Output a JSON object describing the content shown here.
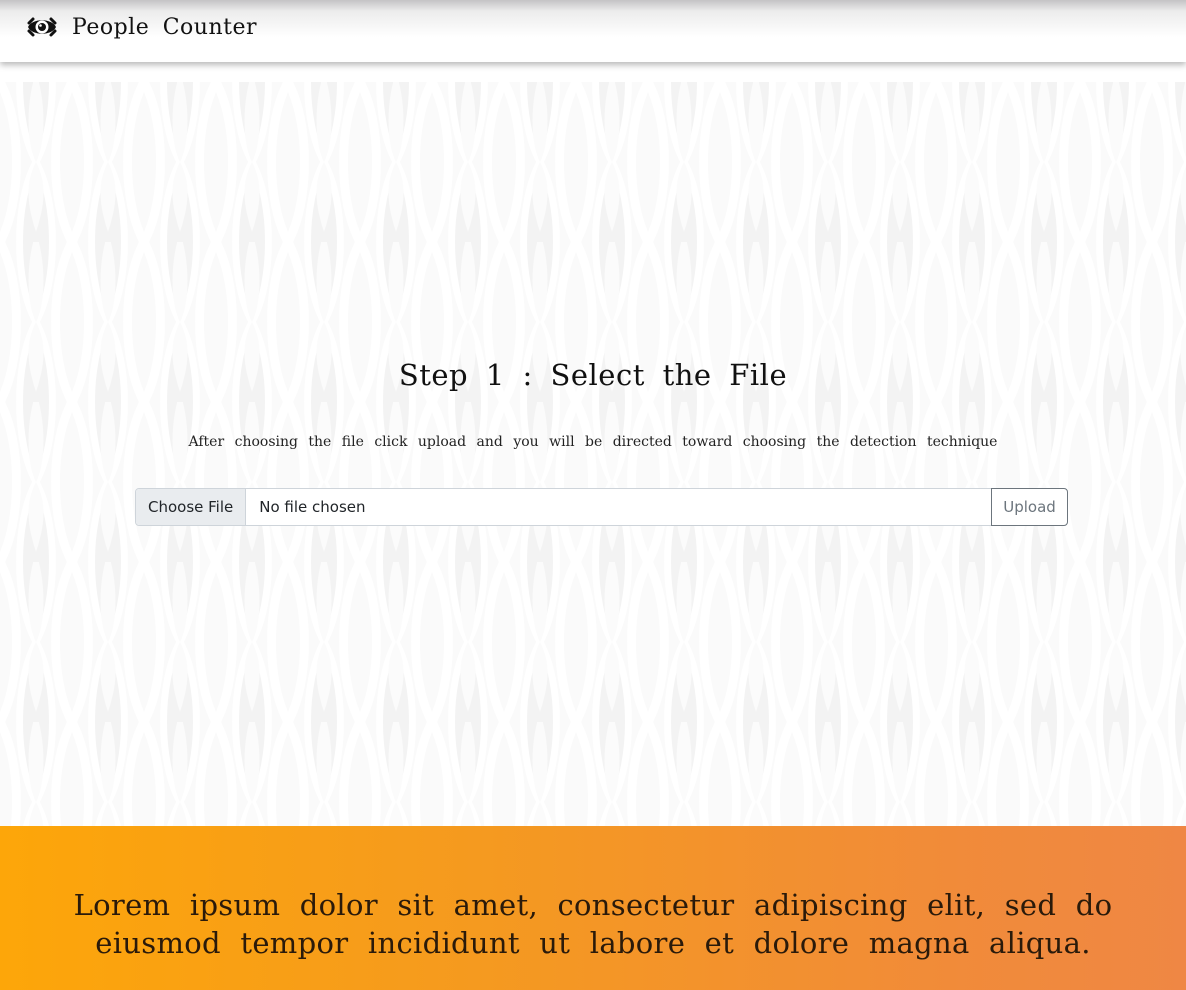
{
  "navbar": {
    "brand_icon": "eye-icon",
    "brand_name": "People Counter"
  },
  "main": {
    "step_title": "Step 1 : Select the File",
    "description": "After choosing the file click upload and you will be directed toward choosing the detection technique",
    "file_input": {
      "button_label": "Choose File",
      "status_text": "No file chosen"
    },
    "upload_label": "Upload"
  },
  "footer": {
    "text": "Lorem ipsum dolor sit amet, consectetur adipiscing elit, sed do eiusmod tempor incididunt ut labore et dolore magna aliqua."
  },
  "colors": {
    "footer_gradient_start": "#fda609",
    "footer_gradient_end": "#ef8744",
    "upload_border": "#6c757d",
    "file_button_bg": "#e9ecef"
  }
}
